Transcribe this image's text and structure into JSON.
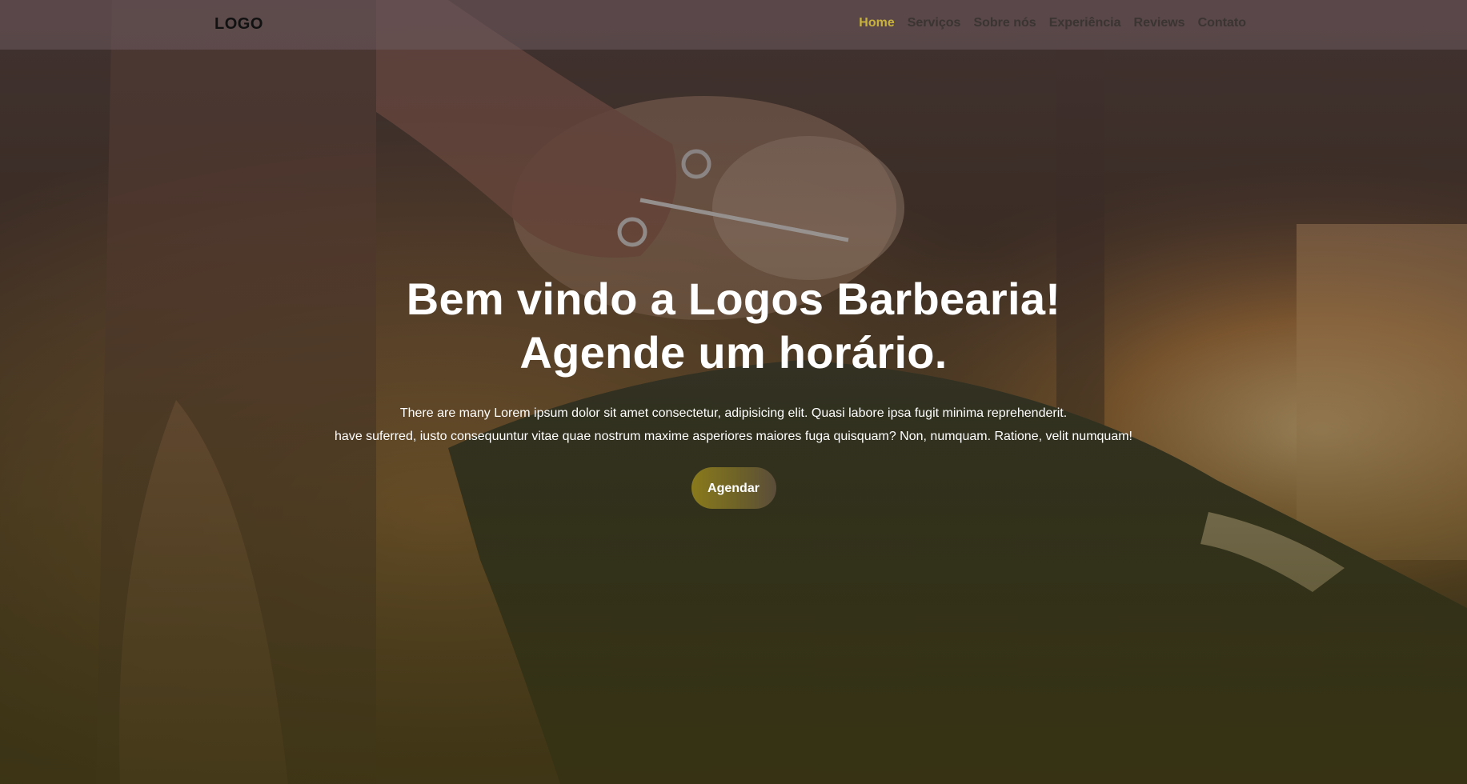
{
  "navbar": {
    "logo": "LOGO",
    "items": [
      {
        "label": "Home",
        "active": true
      },
      {
        "label": "Serviços",
        "active": false
      },
      {
        "label": "Sobre nós",
        "active": false
      },
      {
        "label": "Experiência",
        "active": false
      },
      {
        "label": "Reviews",
        "active": false
      },
      {
        "label": "Contato",
        "active": false
      }
    ]
  },
  "hero": {
    "headline_line1": "Bem vindo a Logos Barbearia!",
    "headline_line2": "Agende um horário.",
    "paragraph_line1": "There are many Lorem ipsum dolor sit amet consectetur, adipisicing elit. Quasi labore ipsa fugit minima reprehenderit.",
    "paragraph_line2": "have suferred, iusto consequuntur vitae quae nostrum maxime asperiores maiores fuga quisquam? Non, numquam. Ratione, velit numquam!",
    "cta_label": "Agendar"
  },
  "colors": {
    "accent": "#c9b23a",
    "button": "#7a6c22",
    "overlay_bottom": "#3a3412"
  }
}
